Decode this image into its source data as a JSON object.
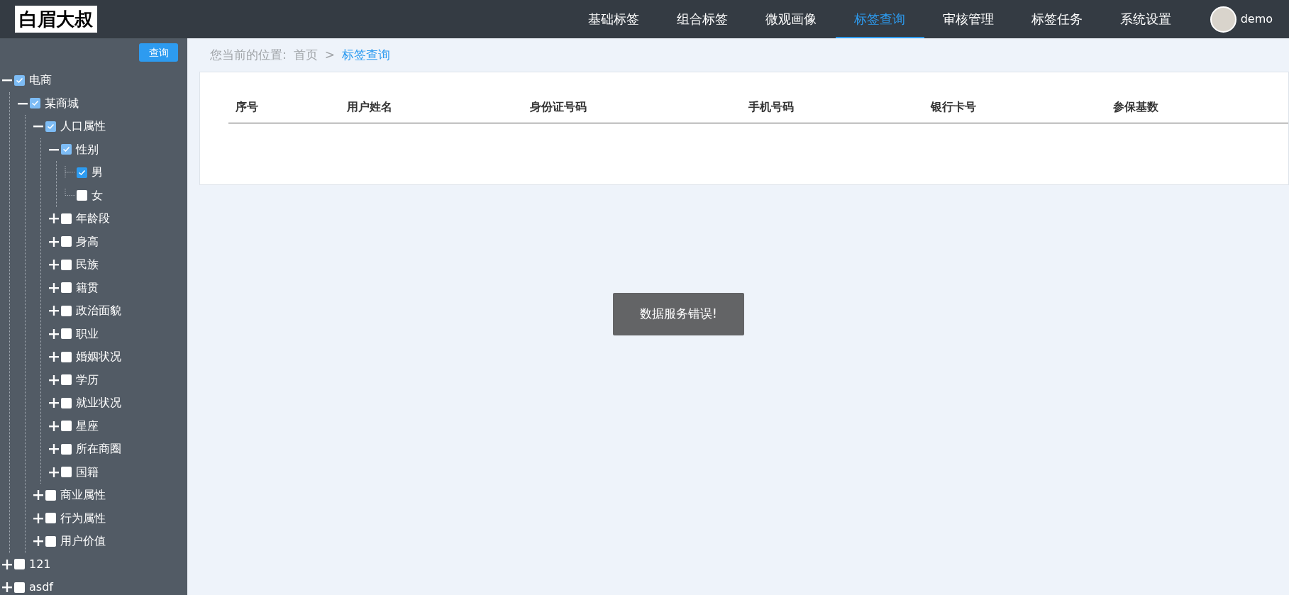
{
  "logo": "白眉大叔",
  "nav": [
    {
      "label": "基础标签",
      "selected": false
    },
    {
      "label": "组合标签",
      "selected": false
    },
    {
      "label": "微观画像",
      "selected": false
    },
    {
      "label": "标签查询",
      "selected": true
    },
    {
      "label": "审核管理",
      "selected": false
    },
    {
      "label": "标签任务",
      "selected": false
    },
    {
      "label": "系统设置",
      "selected": false
    }
  ],
  "user": {
    "name": "demo"
  },
  "sidebar": {
    "query_button": "查询",
    "tree": [
      {
        "label": "电商",
        "expanded": true,
        "checked": true,
        "partial": true,
        "children": [
          {
            "label": "某商城",
            "expanded": true,
            "checked": true,
            "partial": true,
            "children": [
              {
                "label": "人口属性",
                "expanded": true,
                "checked": true,
                "partial": true,
                "children": [
                  {
                    "label": "性别",
                    "expanded": true,
                    "checked": true,
                    "partial": true,
                    "children": [
                      {
                        "label": "男",
                        "checked": true
                      },
                      {
                        "label": "女",
                        "checked": false
                      }
                    ]
                  },
                  {
                    "label": "年龄段",
                    "expanded": false,
                    "checked": false
                  },
                  {
                    "label": "身高",
                    "expanded": false,
                    "checked": false
                  },
                  {
                    "label": "民族",
                    "expanded": false,
                    "checked": false
                  },
                  {
                    "label": "籍贯",
                    "expanded": false,
                    "checked": false
                  },
                  {
                    "label": "政治面貌",
                    "expanded": false,
                    "checked": false
                  },
                  {
                    "label": "职业",
                    "expanded": false,
                    "checked": false
                  },
                  {
                    "label": "婚姻状况",
                    "expanded": false,
                    "checked": false
                  },
                  {
                    "label": "学历",
                    "expanded": false,
                    "checked": false
                  },
                  {
                    "label": "就业状况",
                    "expanded": false,
                    "checked": false
                  },
                  {
                    "label": "星座",
                    "expanded": false,
                    "checked": false
                  },
                  {
                    "label": "所在商圈",
                    "expanded": false,
                    "checked": false
                  },
                  {
                    "label": "国籍",
                    "expanded": false,
                    "checked": false
                  }
                ]
              },
              {
                "label": "商业属性",
                "expanded": false,
                "checked": false
              },
              {
                "label": "行为属性",
                "expanded": false,
                "checked": false
              },
              {
                "label": "用户价值",
                "expanded": false,
                "checked": false
              }
            ]
          }
        ]
      },
      {
        "label": "121",
        "expanded": false,
        "checked": false
      },
      {
        "label": "asdf",
        "expanded": false,
        "checked": false
      }
    ]
  },
  "breadcrumb": {
    "prefix": "您当前的位置:",
    "items": [
      {
        "label": "首页",
        "selected": false
      },
      {
        "label": "标签查询",
        "selected": true
      }
    ],
    "separator": ">"
  },
  "table": {
    "columns": [
      "序号",
      "用户姓名",
      "身份证号码",
      "手机号码",
      "银行卡号",
      "参保基数"
    ]
  },
  "toast": "数据服务错误!"
}
